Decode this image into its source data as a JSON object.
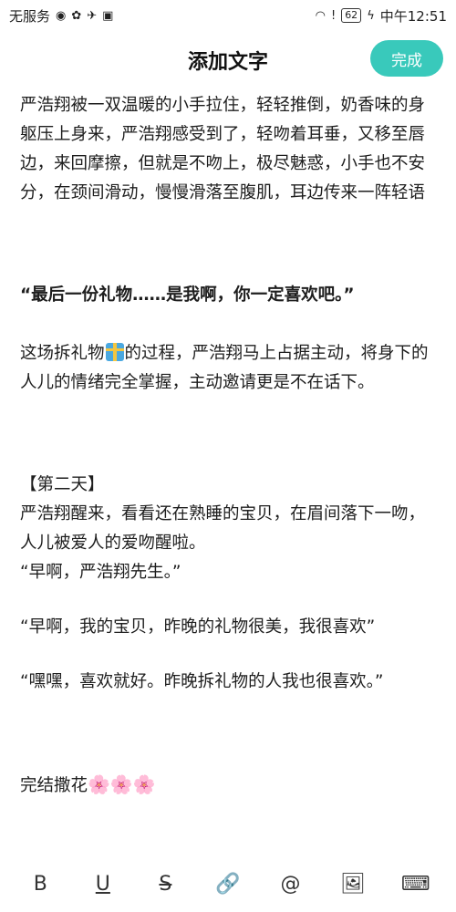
{
  "status_bar": {
    "carrier": "无服务",
    "battery": "62",
    "time": "中午12:51"
  },
  "nav": {
    "title": "添加文字",
    "done_label": "完成"
  },
  "content": {
    "p1": "严浩翔被一双温暖的小手拉住，轻轻推倒，奶香味的身躯压上身来，严浩翔感受到了，轻吻着耳垂，又移至唇边，来回摩擦，但就是不吻上，极尽魅惑，小手也不安分，在颈间滑动，慢慢滑落至腹肌，耳边传来一阵轻语",
    "p2": "“最后一份礼物……是我啊，你一定喜欢吧。”",
    "p3a": "这场拆礼物",
    "p3b": "的过程，严浩翔马上占据主动，将身下的人儿的情绪完全掌握，主动邀请更是不在话下。",
    "p4": "【第二天】",
    "p5": "严浩翔醒来，看看还在熟睡的宝贝，在眉间落下一吻，人儿被爱人的爱吻醒啦。",
    "p6": "“早啊，严浩翔先生。”",
    "p7": "“早啊，我的宝贝，昨晚的礼物很美，我很喜欢”",
    "p8": "“嘿嘿，喜欢就好。昨晚拆礼物的人我也很喜欢。”",
    "p9": "完结撒花",
    "blossoms": "🌸🌸🌸"
  },
  "toolbar": {
    "bold": "B",
    "underline": "U",
    "strike": "S",
    "link": "🔗",
    "at": "@",
    "image": "🖼",
    "keyboard": "⌨"
  }
}
